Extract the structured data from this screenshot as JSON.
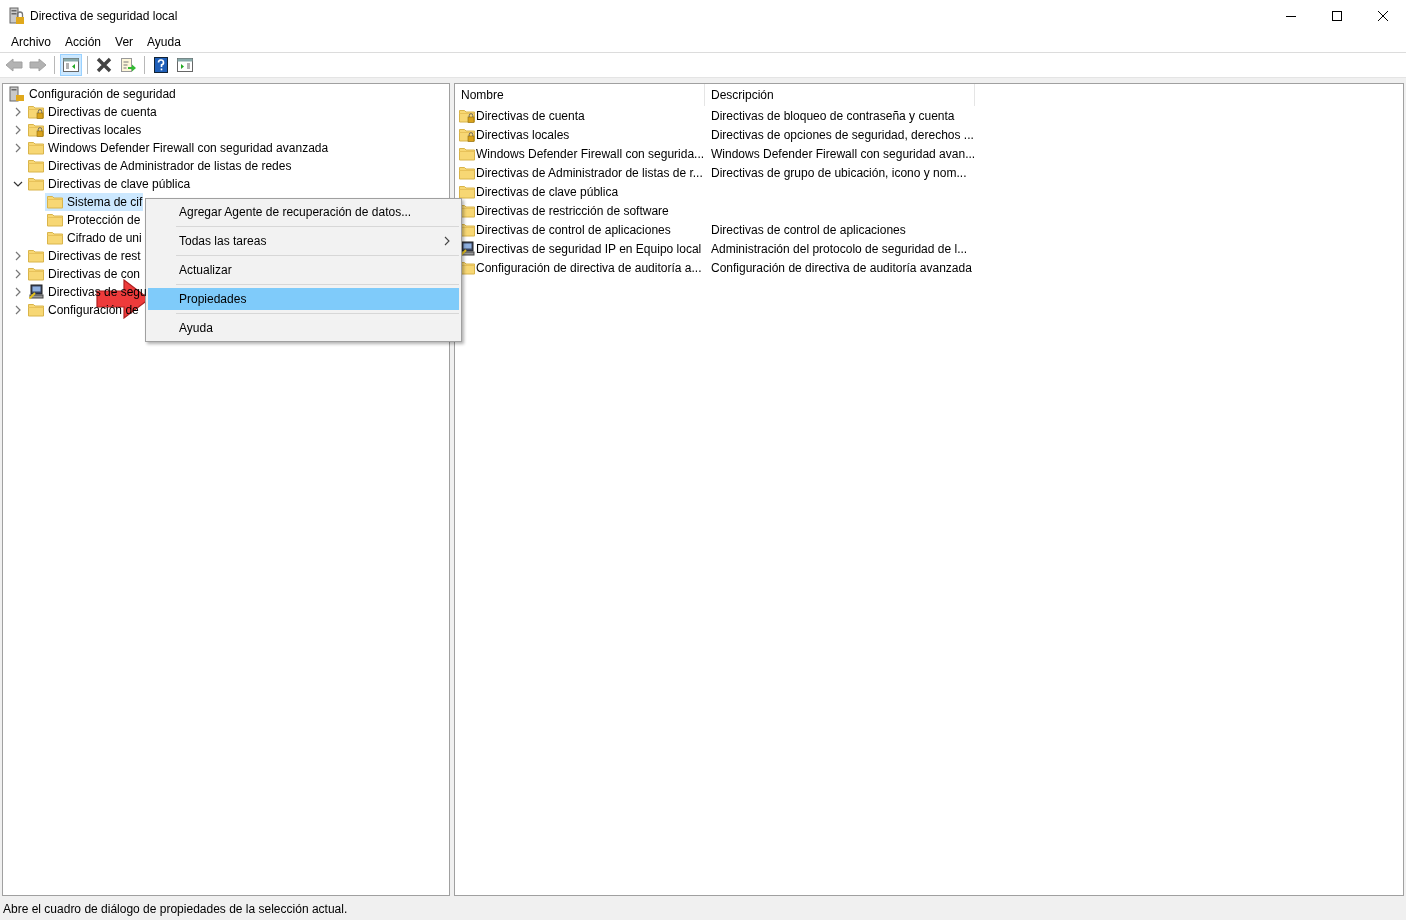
{
  "window": {
    "title": "Directiva de seguridad local"
  },
  "menu": [
    "Archivo",
    "Acción",
    "Ver",
    "Ayuda"
  ],
  "toolbar": [
    [
      {
        "kind": "back",
        "disabled": true,
        "pressed": false
      },
      {
        "kind": "forward",
        "disabled": true,
        "pressed": false
      }
    ],
    [
      {
        "kind": "tree-toggle",
        "disabled": false,
        "pressed": true
      }
    ],
    [
      {
        "kind": "delete",
        "disabled": false,
        "pressed": false
      },
      {
        "kind": "export",
        "disabled": false,
        "pressed": false
      }
    ],
    [
      {
        "kind": "help",
        "disabled": false,
        "pressed": false
      },
      {
        "kind": "action-pane",
        "disabled": false,
        "pressed": false
      }
    ]
  ],
  "tree": {
    "label": "Configuración de seguridad",
    "kind": "policy",
    "children": [
      {
        "label": "Directivas de cuenta",
        "kind": "locked-folder",
        "expanded": false,
        "selected": false
      },
      {
        "label": "Directivas locales",
        "kind": "locked-folder",
        "expanded": false,
        "selected": false
      },
      {
        "label": "Windows Defender Firewall con seguridad avanzada",
        "kind": "folder",
        "expanded": false,
        "selected": false
      },
      {
        "label": "Directivas de Administrador de listas de redes",
        "kind": "folder",
        "selected": false
      },
      {
        "label": "Directivas de clave pública",
        "kind": "folder",
        "expanded": true,
        "selected": false,
        "children": [
          {
            "label": "Sistema de cif",
            "kind": "folder",
            "selected": true
          },
          {
            "label": "Protección de",
            "kind": "folder",
            "selected": false
          },
          {
            "label": "Cifrado de uni",
            "kind": "folder",
            "selected": false
          }
        ]
      },
      {
        "label": "Directivas de rest",
        "kind": "folder",
        "expanded": false,
        "selected": false
      },
      {
        "label": "Directivas de con",
        "kind": "folder",
        "expanded": false,
        "selected": false
      },
      {
        "label": "Directivas de segu",
        "kind": "network",
        "expanded": false,
        "selected": false
      },
      {
        "label": "Configuración de",
        "kind": "folder",
        "expanded": false,
        "selected": false
      }
    ]
  },
  "list": {
    "columns": [
      "Nombre",
      "Descripción"
    ],
    "rows": [
      {
        "name": "Directivas de cuenta",
        "kind": "locked-folder",
        "description": "Directivas de bloqueo de contraseña y cuenta"
      },
      {
        "name": "Directivas locales",
        "kind": "locked-folder",
        "description": "Directivas de opciones de seguridad, derechos ..."
      },
      {
        "name": "Windows Defender Firewall con segurida...",
        "kind": "folder",
        "description": "Windows Defender Firewall con seguridad avan..."
      },
      {
        "name": "Directivas de Administrador de listas de r...",
        "kind": "folder",
        "description": "Directivas de grupo de ubicación, icono y nom..."
      },
      {
        "name": "Directivas de clave pública",
        "kind": "folder"
      },
      {
        "name": "Directivas de restricción de software",
        "kind": "folder"
      },
      {
        "name": "Directivas de control de aplicaciones",
        "kind": "folder",
        "description": "Directivas de control de aplicaciones"
      },
      {
        "name": "Directivas de seguridad IP en Equipo local",
        "kind": "network",
        "description": "Administración del protocolo de seguridad de l..."
      },
      {
        "name": "Configuración de directiva de auditoría a...",
        "kind": "folder",
        "description": "Configuración de directiva de auditoría avanzada"
      }
    ]
  },
  "context_menu": [
    {
      "label": "Agregar Agente de recuperación de datos...",
      "submenu": false,
      "selected": false
    },
    {
      "label": "Todas las tareas",
      "submenu": true,
      "selected": false
    },
    {
      "label": "Actualizar",
      "submenu": false,
      "selected": false
    },
    {
      "label": "Propiedades",
      "submenu": false,
      "selected": true
    },
    {
      "label": "Ayuda",
      "submenu": false,
      "selected": false
    }
  ],
  "annotation_arrow": true,
  "status_bar": "Abre el cuadro de diálogo de propiedades de la selección actual."
}
